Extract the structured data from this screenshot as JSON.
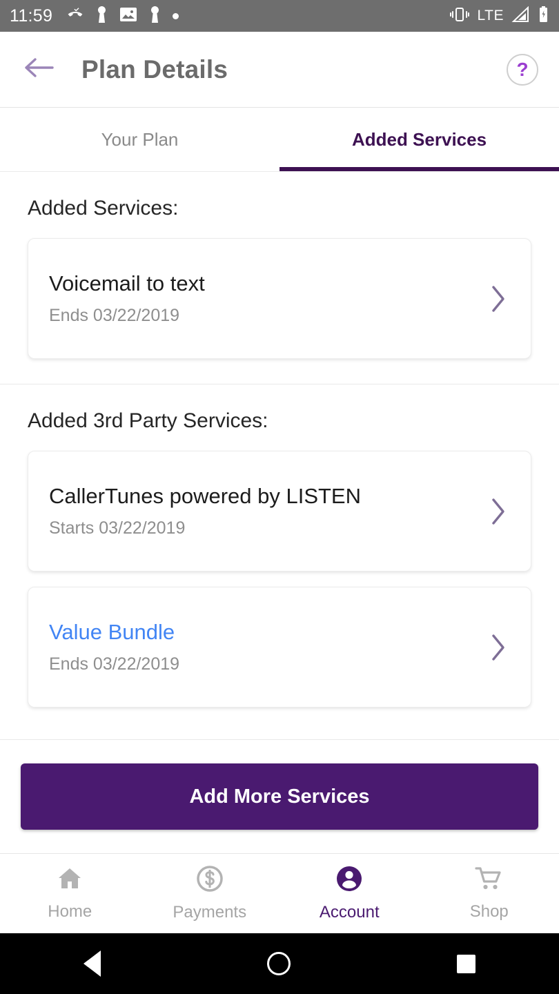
{
  "statusbar": {
    "time": "11:59",
    "left_icons": [
      "missed-call-icon",
      "person-icon",
      "image-icon",
      "person-icon",
      "dot-icon"
    ],
    "network_label": "LTE",
    "right_icons": [
      "vibrate-icon",
      "signal-icon",
      "battery-charging-icon"
    ]
  },
  "header": {
    "back_icon": "back-arrow-icon",
    "title": "Plan Details",
    "help_label": "?"
  },
  "tabs": [
    {
      "label": "Your Plan",
      "active": false
    },
    {
      "label": "Added Services",
      "active": true
    }
  ],
  "sections": [
    {
      "heading": "Added Services:",
      "cards": [
        {
          "title": "Voicemail to text",
          "subtitle": "Ends 03/22/2019",
          "link": false,
          "chevron": "chevron-right-icon"
        }
      ]
    },
    {
      "heading": "Added 3rd Party Services:",
      "cards": [
        {
          "title": "CallerTunes powered by LISTEN",
          "subtitle": "Starts 03/22/2019",
          "link": false,
          "chevron": "chevron-right-icon"
        },
        {
          "title": "Value Bundle",
          "subtitle": "Ends 03/22/2019",
          "link": true,
          "chevron": "chevron-right-icon"
        }
      ]
    }
  ],
  "cta": {
    "label": "Add More Services"
  },
  "bottom_nav": [
    {
      "label": "Home",
      "icon": "home-icon",
      "active": false
    },
    {
      "label": "Payments",
      "icon": "dollar-circle-icon",
      "active": false
    },
    {
      "label": "Account",
      "icon": "person-circle-icon",
      "active": true
    },
    {
      "label": "Shop",
      "icon": "cart-icon",
      "active": false
    }
  ],
  "android_nav": [
    "back-triangle-icon",
    "home-circle-icon",
    "recents-square-icon"
  ],
  "colors": {
    "brand_purple": "#4a1a70",
    "tab_active": "#3d1152",
    "link_blue": "#4285f4",
    "chevron": "#7e6e96",
    "statusbar_bg": "#6e6e6e"
  }
}
